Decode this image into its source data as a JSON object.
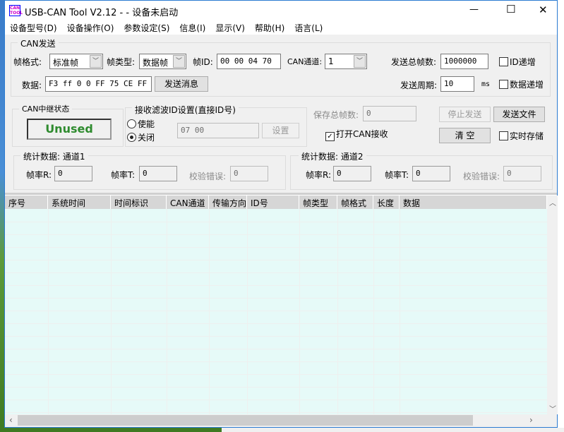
{
  "window": {
    "title": "USB-CAN Tool V2.12 -  - 设备未启动",
    "icon_text": "CAN TOOL",
    "min": "—",
    "max": "☐",
    "close": "✕"
  },
  "menu": [
    "设备型号(D)",
    "设备操作(O)",
    "参数设定(S)",
    "信息(I)",
    "显示(V)",
    "帮助(H)",
    "语言(L)"
  ],
  "send": {
    "group": "CAN发送",
    "frame_format_label": "帧格式:",
    "frame_format": "标准帧",
    "frame_type_label": "帧类型:",
    "frame_type": "数据帧",
    "frame_id_label": "帧ID:",
    "frame_id": "00 00 04 70",
    "channel_label": "CAN通道:",
    "channel": "1",
    "total_label": "发送总帧数:",
    "total": "1000000",
    "id_inc": "ID递增",
    "data_label": "数据:",
    "data": "F3 ff 0 0 FF 75 CE FF",
    "send_btn": "发送消息",
    "period_label": "发送周期:",
    "period": "10",
    "period_unit": "ms",
    "data_inc": "数据递增"
  },
  "relay": {
    "group": "CAN中继状态",
    "status": "Unused",
    "status_color": "#2e8b2e"
  },
  "filter": {
    "group": "接收滤波ID设置(直接ID号)",
    "enable": "使能",
    "close": "关闭",
    "selected": "关闭",
    "value": "07 00",
    "set_btn": "设置"
  },
  "save": {
    "label": "保存总帧数:",
    "value": "0",
    "stop_btn": "停止发送",
    "send_file_btn": "发送文件",
    "open_recv": "打开CAN接收",
    "open_recv_checked": true,
    "clear_btn": "清 空",
    "realtime_save": "实时存储"
  },
  "stats1": {
    "group": "统计数据: 通道1",
    "rate_r_label": "帧率R:",
    "rate_r": "0",
    "rate_t_label": "帧率T:",
    "rate_t": "0",
    "err_label": "校验错误:",
    "err": "0"
  },
  "stats2": {
    "group": "统计数据: 通道2",
    "rate_r_label": "帧率R:",
    "rate_r": "0",
    "rate_t_label": "帧率T:",
    "rate_t": "0",
    "err_label": "校验错误:",
    "err": "0"
  },
  "table": {
    "columns": [
      "序号",
      "系统时间",
      "时间标识",
      "CAN通道",
      "传输方向",
      "ID号",
      "帧类型",
      "帧格式",
      "长度",
      "数据"
    ],
    "rows": []
  }
}
